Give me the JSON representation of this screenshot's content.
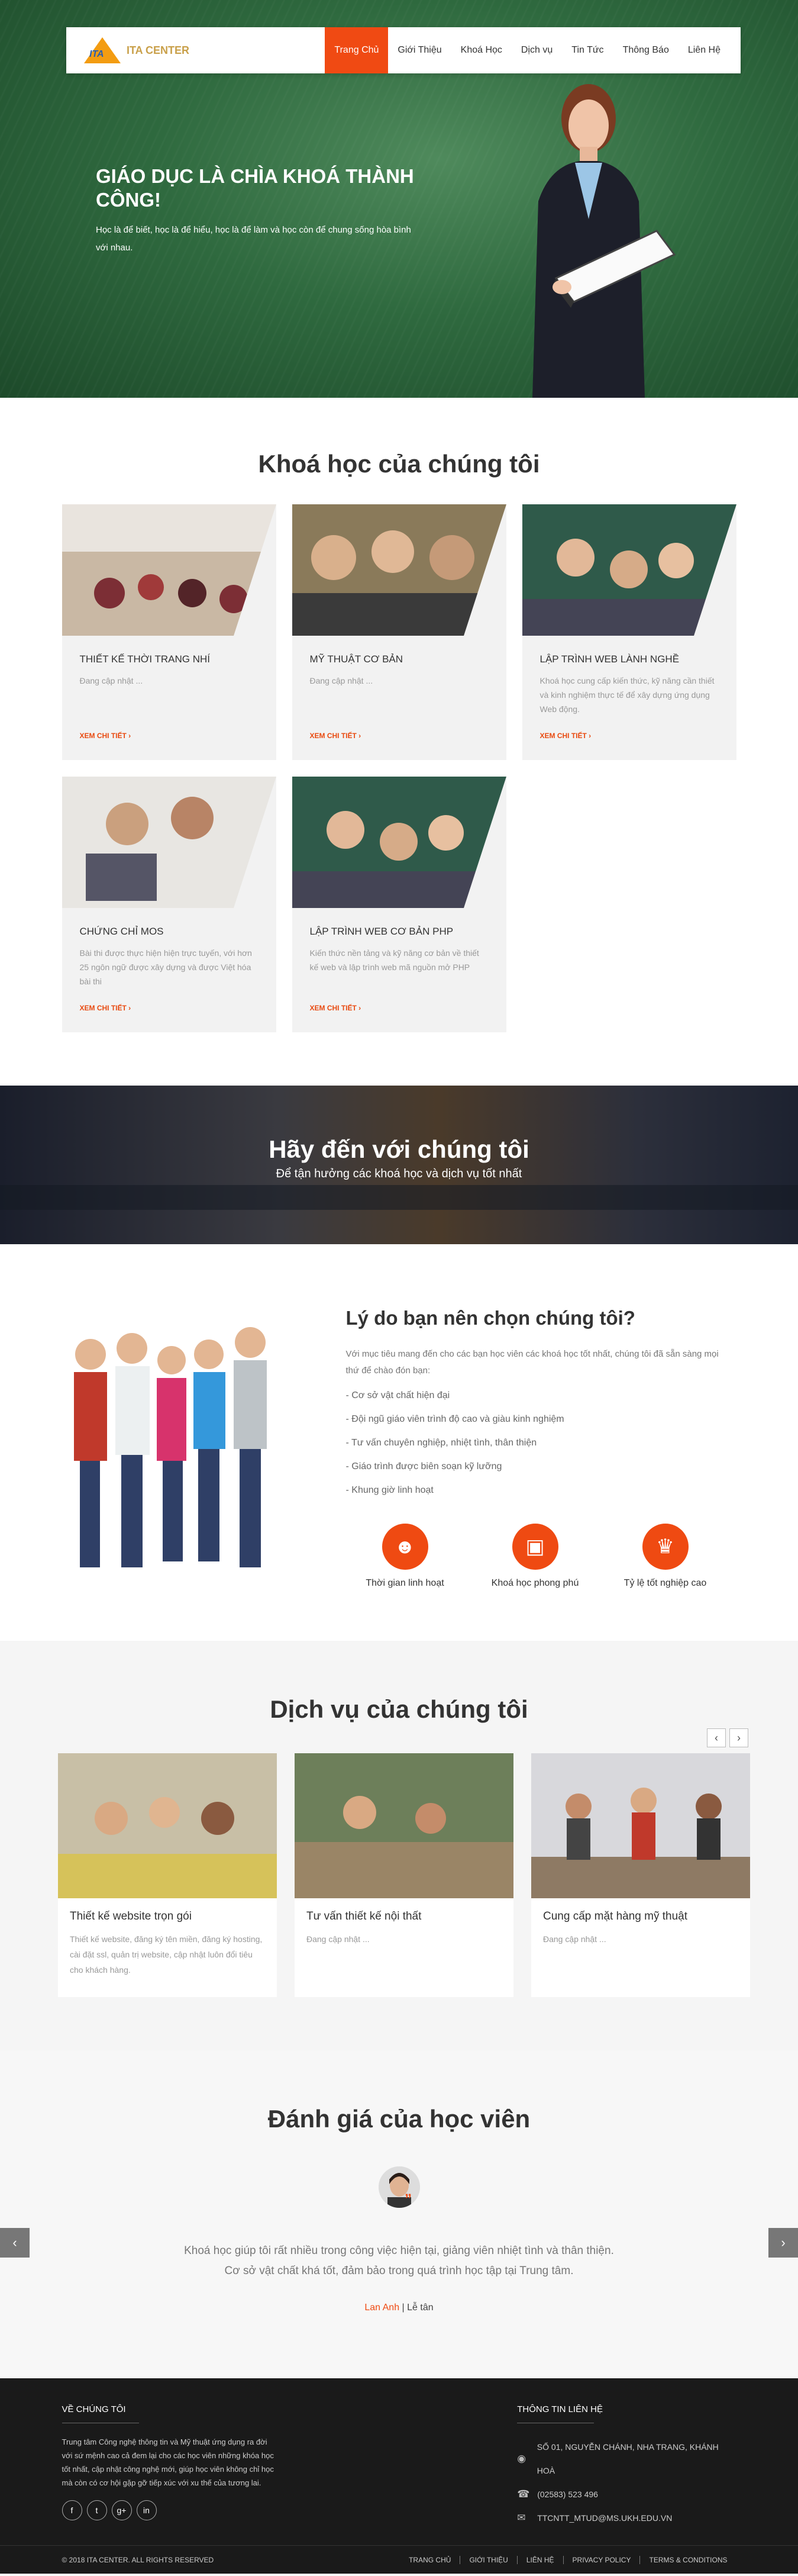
{
  "nav": {
    "logo_mark": "ITA",
    "logo_name": "ITA CENTER",
    "items": [
      "Trang Chủ",
      "Giới Thiệu",
      "Khoá Học",
      "Dịch vụ",
      "Tin Tức",
      "Thông Báo",
      "Liên Hệ"
    ]
  },
  "hero": {
    "title": "GIÁO DỤC LÀ CHÌA KHOÁ THÀNH CÔNG!",
    "subtitle": "Học là để biết, học là để hiểu, học là để làm và học còn để chung sống hòa bình với nhau."
  },
  "courses": {
    "title": "Khoá học của chúng tôi",
    "more_label": "XEM CHI TIẾT ›",
    "items": [
      {
        "title": "THIẾT KẾ THỜI TRANG NHÍ",
        "desc": "Đang cập nhật ..."
      },
      {
        "title": "MỸ THUẬT CƠ BẢN",
        "desc": "Đang cập nhật ..."
      },
      {
        "title": "LẬP TRÌNH WEB LÀNH NGHỀ",
        "desc": "Khoá học cung cấp kiến thức, kỹ năng cần thiết và kinh nghiệm thực tế để xây dựng ứng dụng Web động."
      },
      {
        "title": "CHỨNG CHỈ MOS",
        "desc": "Bài thi được thực hiện hiện trực tuyến, với hơn 25 ngôn ngữ được xây dựng và được Việt hóa bài thi"
      },
      {
        "title": "LẬP TRÌNH WEB CƠ BẢN PHP",
        "desc": "Kiến thức nền tảng và kỹ năng cơ bản về thiết kế web và lập trình web mã nguồn mở PHP"
      }
    ]
  },
  "banner": {
    "title": "Hãy đến với chúng tôi",
    "subtitle": "Để tận hưởng các khoá học và dịch vụ tốt nhất"
  },
  "why": {
    "title": "Lý do bạn nên chọn chúng tôi?",
    "intro": "Với mục tiêu mang đến cho các bạn học viên các khoá học tốt nhất, chúng tôi đã sẵn sàng mọi thứ để chào đón bạn:",
    "points": [
      "- Cơ sở vật chất hiện đại",
      "- Đội ngũ giáo viên trình độ cao và giàu kinh nghiệm",
      "- Tư vấn chuyên nghiệp, nhiệt tình, thân thiện",
      "- Giáo trình được biên soạn kỹ lưỡng",
      "- Khung giờ linh hoạt"
    ],
    "features": [
      "Thời gian linh hoạt",
      "Khoá học phong phú",
      "Tỷ lệ tốt nghiệp cao"
    ]
  },
  "services": {
    "title": "Dịch vụ của chúng tôi",
    "prev": "‹",
    "next": "›",
    "items": [
      {
        "title": "Thiết kế website trọn gói",
        "desc": "Thiết kế website, đăng ký tên miền, đăng ký hosting, cài đặt ssl, quản trị website, cập nhật luôn đổi tiêu cho khách hàng."
      },
      {
        "title": "Tư vấn thiết kế nội thất",
        "desc": "Đang cập nhật ..."
      },
      {
        "title": "Cung cấp mặt hàng mỹ thuật",
        "desc": "Đang cập nhật ..."
      }
    ]
  },
  "testimonial": {
    "title": "Đánh giá của học viên",
    "quote_line1": "Khoá học giúp tôi rất nhiều trong công việc hiện tại, giảng viên nhiệt tình và thân thiện.",
    "quote_line2": "Cơ sở vật chất khá tốt, đảm bảo trong quá trình học tập tại Trung tâm.",
    "name": "Lan Anh",
    "role": " | Lễ tân",
    "prev": "‹",
    "next": "›"
  },
  "footer": {
    "about_title": "VỀ CHÚNG TÔI",
    "about_text": "Trung tâm Công nghệ thông tin và Mỹ thuật ứng dụng ra đời với sứ mệnh cao cả đem lại cho các học viên những khóa học tốt nhất, cập nhật công nghệ mới, giúp học viên không chỉ học mà còn có cơ hội gặp gỡ tiếp xúc với xu thế của tương lai.",
    "social": [
      "f",
      "t",
      "g+",
      "in"
    ],
    "contact_title": "THÔNG TIN LIÊN HỆ",
    "address": "SỐ 01, NGUYỄN CHÁNH, NHA TRANG, KHÁNH HOÀ",
    "phone": "(02583) 523 496",
    "email": "TTCNTT_MTUD@MS.UKH.EDU.VN",
    "copyright": "© 2018 ITA CENTER. ALL RIGHTS RESERVED",
    "links": [
      "TRANG CHỦ",
      "GIỚI THIỆU",
      "LIÊN HỆ",
      "PRIVACY POLICY",
      "TERMS & CONDITIONS"
    ]
  }
}
